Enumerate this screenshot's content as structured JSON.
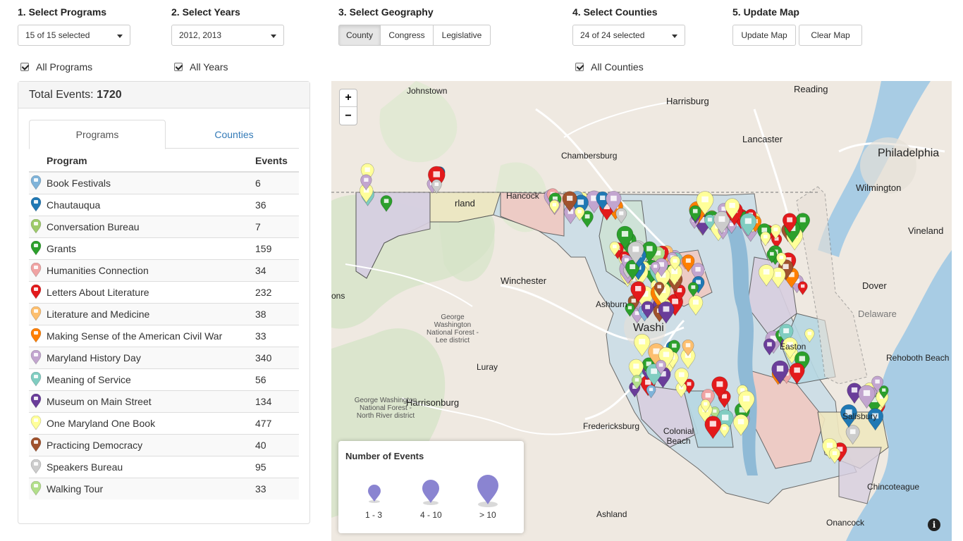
{
  "controls": {
    "programs": {
      "label": "1. Select Programs",
      "value": "15 of 15 selected",
      "all_label": "All Programs"
    },
    "years": {
      "label": "2. Select Years",
      "value": "2012, 2013",
      "all_label": "All Years"
    },
    "geography": {
      "label": "3. Select Geography",
      "options": [
        "County",
        "Congress",
        "Legislative"
      ],
      "selected": "County"
    },
    "counties": {
      "label": "4. Select Counties",
      "value": "24 of 24 selected",
      "all_label": "All Counties"
    },
    "update": {
      "label": "5. Update Map",
      "update_button": "Update Map",
      "clear_button": "Clear Map"
    }
  },
  "panel": {
    "total_label": "Total Events:",
    "total_value": "1720",
    "tabs": [
      "Programs",
      "Counties"
    ],
    "active_tab": "Programs",
    "table_headers": [
      "Program",
      "Events"
    ],
    "rows": [
      {
        "program": "Book Festivals",
        "events": "6",
        "color": "#7fb3d9",
        "icon": "book-festival-icon"
      },
      {
        "program": "Chautauqua",
        "events": "36",
        "color": "#1f78b4",
        "icon": "chautauqua-icon"
      },
      {
        "program": "Conversation Bureau",
        "events": "7",
        "color": "#9ecb6a",
        "icon": "conversation-icon"
      },
      {
        "program": "Grants",
        "events": "159",
        "color": "#2ca02c",
        "icon": "grants-icon"
      },
      {
        "program": "Humanities Connection",
        "events": "34",
        "color": "#f0a3a3",
        "icon": "humanities-connection-icon"
      },
      {
        "program": "Letters About Literature",
        "events": "232",
        "color": "#e31a1c",
        "icon": "letter-icon"
      },
      {
        "program": "Literature and Medicine",
        "events": "38",
        "color": "#fdbf6f",
        "icon": "medicine-cross-icon"
      },
      {
        "program": "Making Sense of the American Civil War",
        "events": "33",
        "color": "#ff7f00",
        "icon": "star-icon"
      },
      {
        "program": "Maryland History Day",
        "events": "340",
        "color": "#c2a5cf",
        "icon": "flag-icon"
      },
      {
        "program": "Meaning of Service",
        "events": "56",
        "color": "#80cdc1",
        "icon": "service-icon"
      },
      {
        "program": "Museum on Main Street",
        "events": "134",
        "color": "#6a3d9a",
        "icon": "museum-icon"
      },
      {
        "program": "One Maryland One Book",
        "events": "477",
        "color": "#ffff99",
        "icon": "open-book-icon"
      },
      {
        "program": "Practicing Democracy",
        "events": "40",
        "color": "#a0522d",
        "icon": "democracy-flag-icon"
      },
      {
        "program": "Speakers Bureau",
        "events": "95",
        "color": "#cccccc",
        "icon": "graduation-cap-icon"
      },
      {
        "program": "Walking Tour",
        "events": "33",
        "color": "#b2df8a",
        "icon": "walking-icon"
      }
    ]
  },
  "map": {
    "zoom_in": "+",
    "zoom_out": "−",
    "info": "i",
    "legend": {
      "title": "Number of Events",
      "items": [
        "1 - 3",
        "4 - 10",
        "> 10"
      ],
      "color": "#8a84d1"
    },
    "cities": [
      "Johnstown",
      "Harrisburg",
      "Reading",
      "Lancaster",
      "Chambersburg",
      "Philadelphia",
      "Wilmington",
      "Vineland",
      "Winchester",
      "Dover",
      "Ashburn",
      "Delaware",
      "Washi",
      "George Washington National Forest - Lee district",
      "Luray",
      "Rehoboth Beach",
      "Harrisonburg",
      "George Washington National Forest - North River district",
      "Fredericksburg",
      "Colonial Beach",
      "Salisbury",
      "Chincoteague",
      "Ashland",
      "Onancock",
      "ons",
      "Hancock",
      "rland",
      "Easton"
    ]
  }
}
